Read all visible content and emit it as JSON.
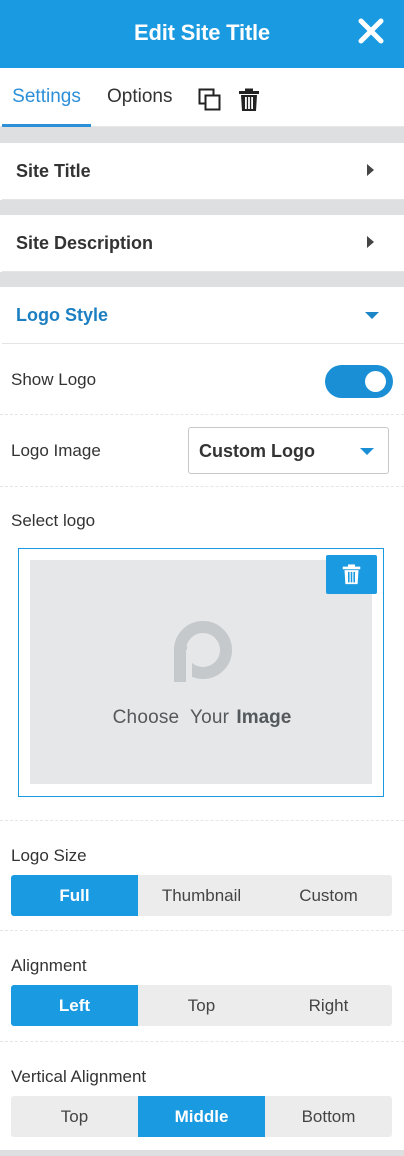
{
  "header": {
    "title": "Edit Site Title",
    "close_icon": "close-icon"
  },
  "tabs": [
    {
      "label": "Settings",
      "active": true
    },
    {
      "label": "Options",
      "active": false
    }
  ],
  "toolbar": {
    "duplicate_icon": "copy-icon",
    "delete_icon": "trash-icon"
  },
  "sections": [
    {
      "label": "Site Title",
      "expanded": false
    },
    {
      "label": "Site Description",
      "expanded": false
    },
    {
      "label": "Logo Style",
      "expanded": true
    }
  ],
  "logo_style": {
    "show_logo": {
      "label": "Show Logo",
      "enabled": true
    },
    "logo_image": {
      "label": "Logo Image",
      "value": "Custom Logo"
    },
    "select_logo": {
      "label": "Select logo",
      "placeholder_text": "Choose  Your",
      "placeholder_bold": "Image",
      "delete_icon": "trash-icon"
    },
    "logo_size": {
      "label": "Logo Size",
      "options": [
        "Full",
        "Thumbnail",
        "Custom"
      ],
      "selected": "Full"
    },
    "alignment": {
      "label": "Alignment",
      "options": [
        "Left",
        "Top",
        "Right"
      ],
      "selected": "Left"
    },
    "vertical_alignment": {
      "label": "Vertical Alignment",
      "options": [
        "Top",
        "Middle",
        "Bottom"
      ],
      "selected": "Middle"
    }
  },
  "colors": {
    "accent": "#1a9ae0",
    "section_active": "#1c7fc1",
    "gap": "#dedfe0"
  }
}
